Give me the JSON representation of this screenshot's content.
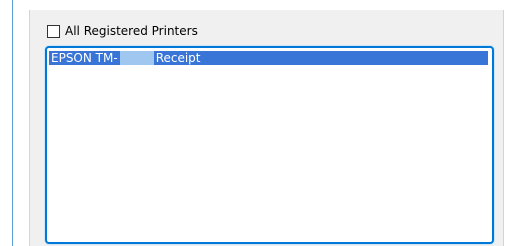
{
  "printer_selection": {
    "all_registered_printers": {
      "label": "All Registered Printers",
      "checked": false
    },
    "printers": [
      {
        "name_prefix": "EPSON TM-",
        "name_suffix": "Receipt",
        "selected": true
      }
    ]
  },
  "colors": {
    "selection": "#3875d6",
    "focus_border": "#0078d7",
    "masked_region": "#9fc7ef"
  }
}
